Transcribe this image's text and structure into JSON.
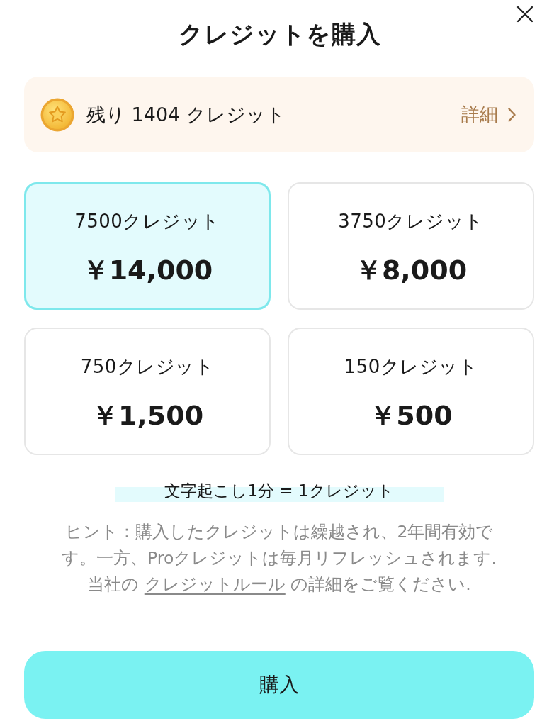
{
  "header": {
    "title": "クレジットを購入"
  },
  "balance": {
    "text": "残り 1404 クレジット",
    "details_label": "詳細"
  },
  "packages": [
    {
      "credits": "7500クレジット",
      "price": "￥14,000",
      "selected": true
    },
    {
      "credits": "3750クレジット",
      "price": "￥8,000",
      "selected": false
    },
    {
      "credits": "750クレジット",
      "price": "￥1,500",
      "selected": false
    },
    {
      "credits": "150クレジット",
      "price": "￥500",
      "selected": false
    }
  ],
  "rate": "文字起こし1分 = 1クレジット",
  "hint": {
    "text": "ヒント：購入したクレジットは繰越され、2年間有効です。一方、Proクレジットは毎月リフレッシュされます.",
    "rules_prefix": "当社の ",
    "rules_link": "クレジットルール",
    "rules_suffix": " の詳細をご覧ください."
  },
  "purchase_button": "購入"
}
